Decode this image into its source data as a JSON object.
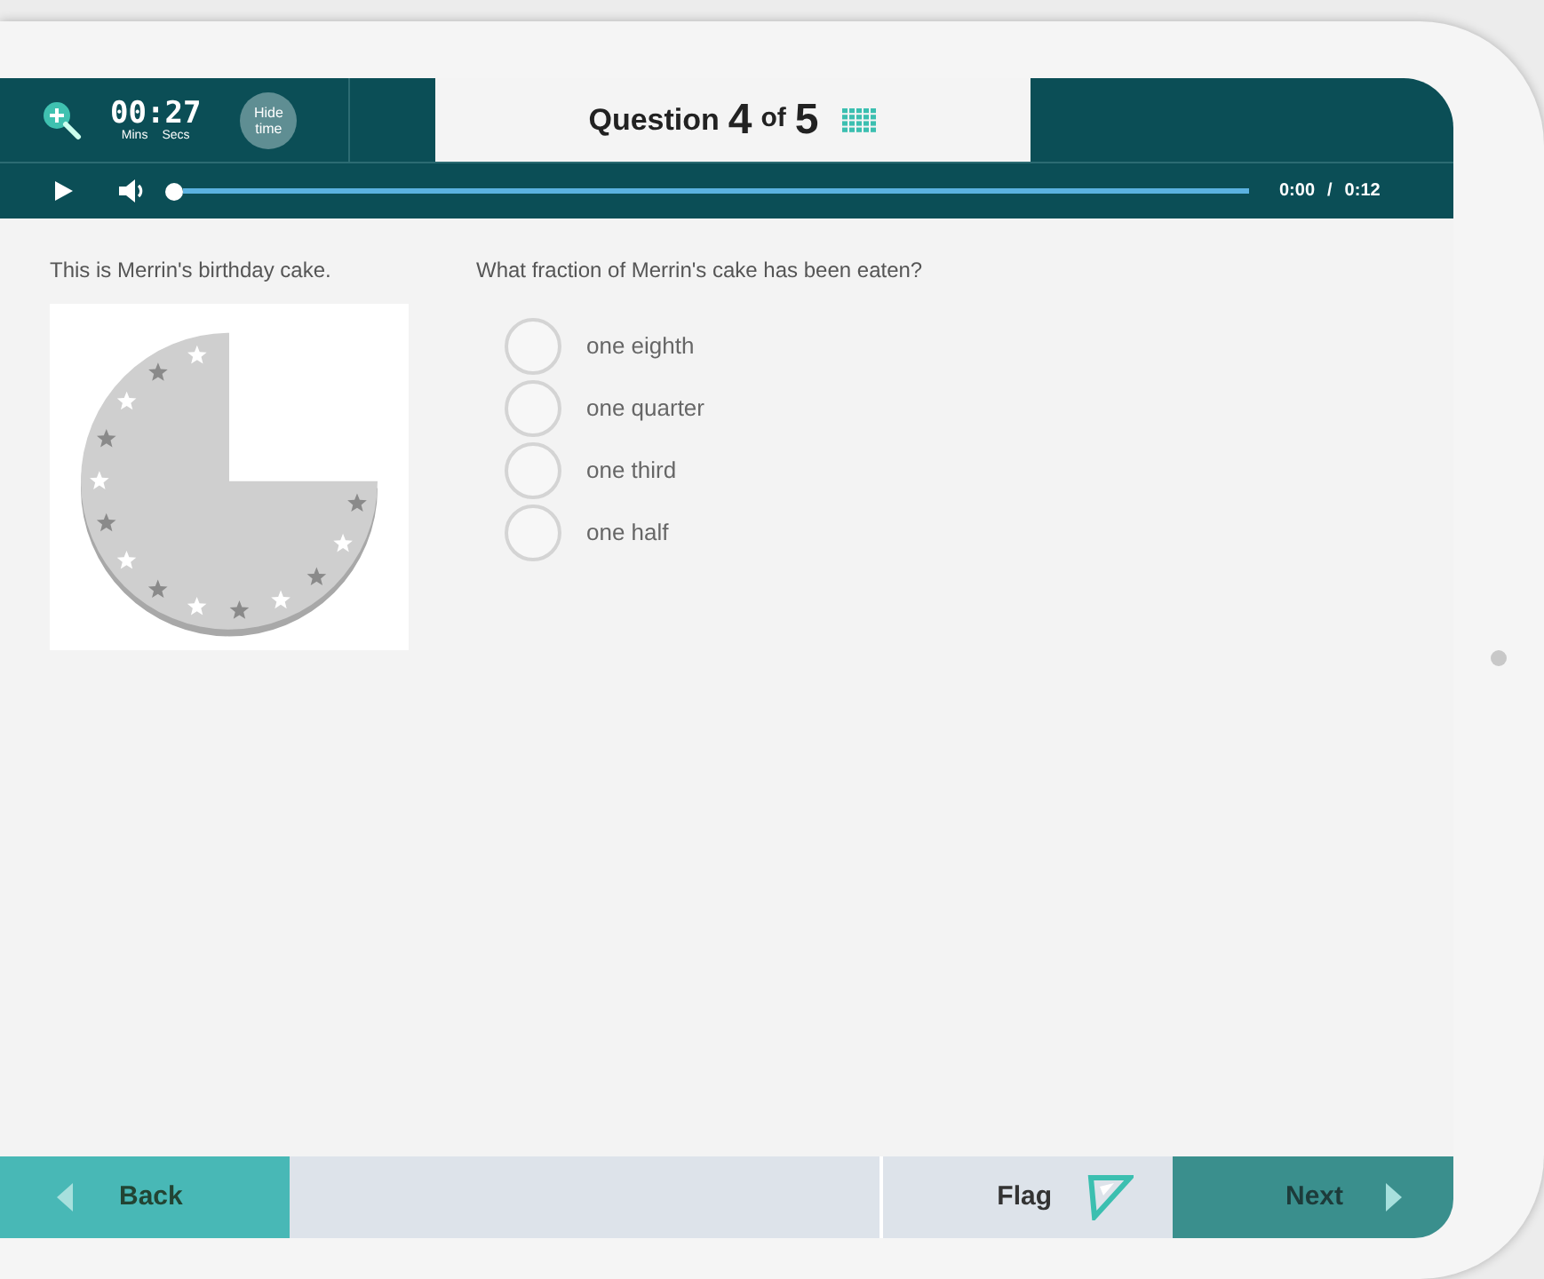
{
  "timer": {
    "time": "00:27",
    "minutes_label": "Mins",
    "seconds_label": "Secs",
    "hide_button": "Hide time"
  },
  "question_header": {
    "prefix": "Question",
    "current": "4",
    "of": "of",
    "total": "5"
  },
  "audio": {
    "level": 0,
    "elapsed": "0:00",
    "separator": "/",
    "duration": "0:12"
  },
  "stimulus": {
    "caption": "This is Merrin's birthday cake."
  },
  "question": {
    "prompt": "What fraction of Merrin's cake has been eaten?",
    "options": [
      {
        "label": "one eighth",
        "selected": false
      },
      {
        "label": "one quarter",
        "selected": false
      },
      {
        "label": "one third",
        "selected": false
      },
      {
        "label": "one half",
        "selected": false
      }
    ]
  },
  "footer": {
    "back": "Back",
    "flag": "Flag",
    "flagged": false,
    "next": "Next"
  }
}
